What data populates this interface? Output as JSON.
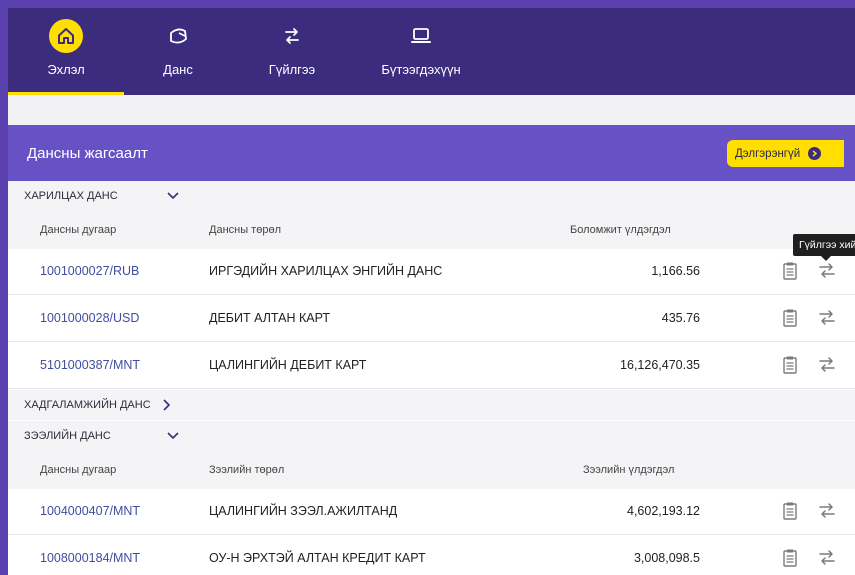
{
  "nav": {
    "tabs": [
      {
        "label": "Эхлэл",
        "icon": "home-icon"
      },
      {
        "label": "Данс",
        "icon": "wallet-icon"
      },
      {
        "label": "Гүйлгээ",
        "icon": "transfer-icon"
      },
      {
        "label": "Бүтээгдэхүүн",
        "icon": "laptop-icon"
      }
    ],
    "active": "Эхлэл"
  },
  "summary": {
    "title": "Дансны жагсаалт",
    "more_label": "Дэлгэрэнгүй"
  },
  "groups": {
    "current": {
      "title": "ХАРИЛЦАХ ДАНС",
      "col_account": "Дансны дугаар",
      "col_type": "Дансны төрөл",
      "col_balance": "Боломжит үлдэгдэл",
      "rows": [
        {
          "account": "1001000027/RUB",
          "type": "ИРГЭДИЙН ХАРИЛЦАХ ЭНГИЙН ДАНС",
          "balance": "1,166.56"
        },
        {
          "account": "1001000028/USD",
          "type": "ДЕБИТ АЛТАН КАРТ",
          "balance": "435.76"
        },
        {
          "account": "5101000387/MNT",
          "type": "ЦАЛИНГИЙН ДЕБИТ КАРТ",
          "balance": "16,126,470.35"
        }
      ]
    },
    "savings": {
      "title": "ХАДГАЛАМЖИЙН ДАНС"
    },
    "loan": {
      "title": "ЗЭЭЛИЙН ДАНС",
      "col_account": "Дансны дугаар",
      "col_type": "Зээлийн төрөл",
      "col_balance": "Зээлийн үлдэгдэл",
      "rows": [
        {
          "account": "1004000407/MNT",
          "type": "ЦАЛИНГИЙН ЗЭЭЛ.АЖИЛТАНД",
          "balance": "4,602,193.12"
        },
        {
          "account": "1008000184/MNT",
          "type": "ОУ-Н ЭРХТЭЙ АЛТАН КРЕДИТ КАРТ",
          "balance": "3,008,098.5"
        }
      ]
    }
  },
  "tooltip": "Гүйлгээ хийх",
  "colors": {
    "nav_bg": "#3b2c7e",
    "header_bg": "#6652c4",
    "accent": "#ffde00",
    "link": "#3f4ea0"
  }
}
